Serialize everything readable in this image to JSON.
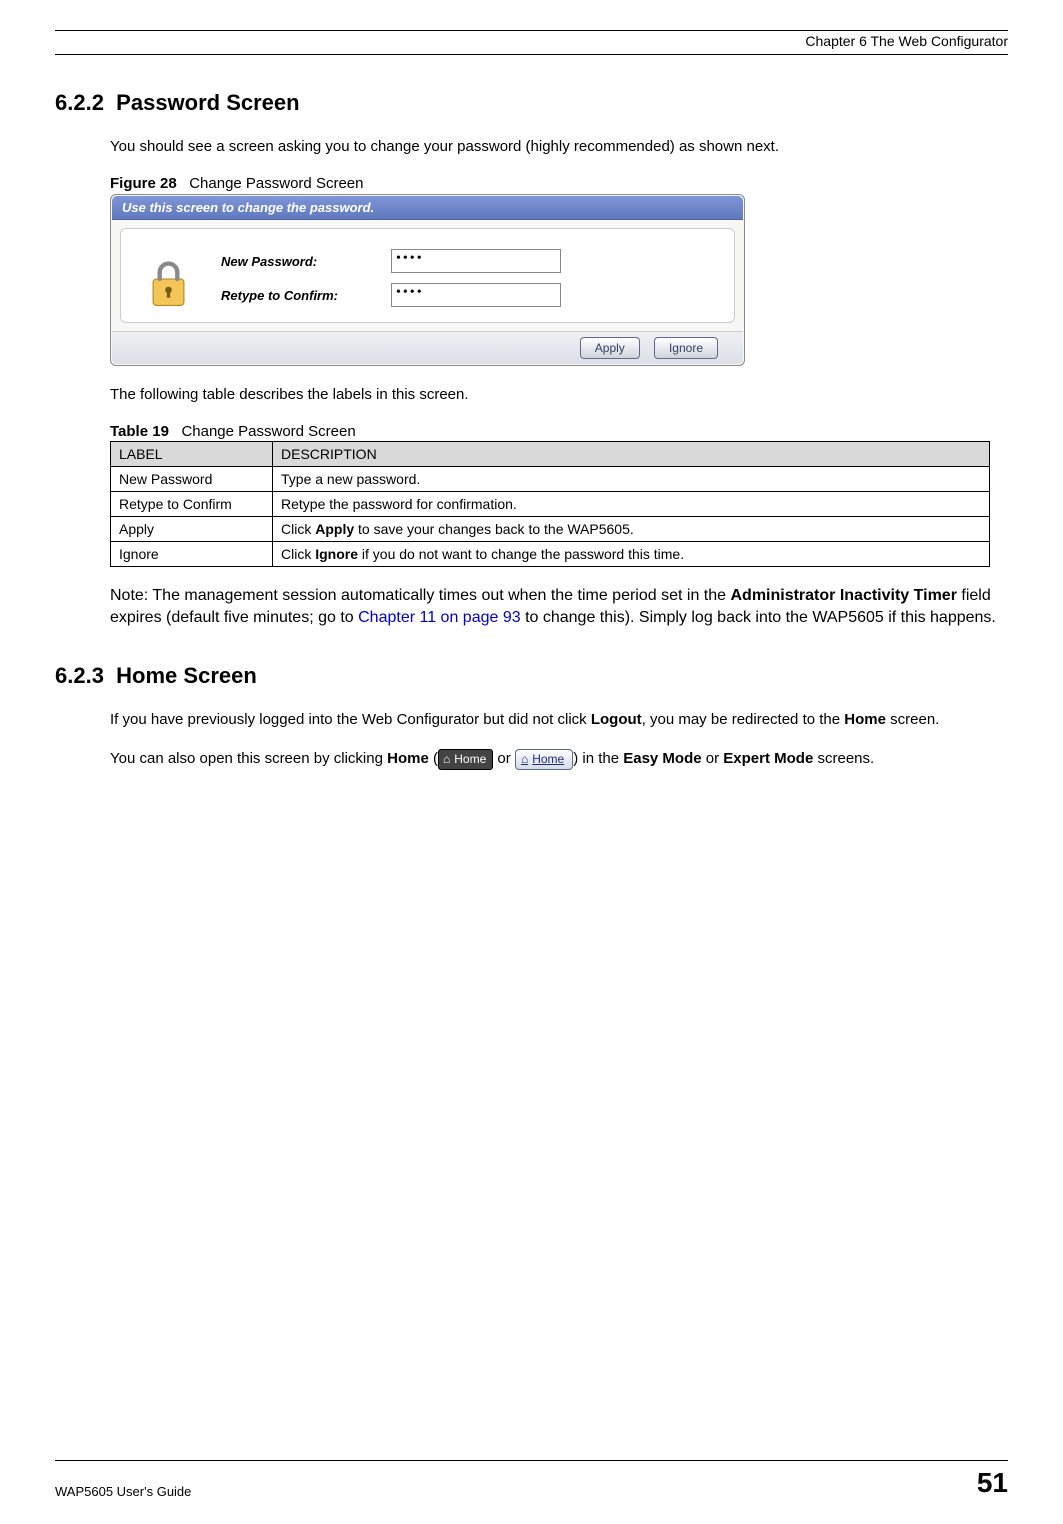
{
  "header": {
    "chapter_line": "Chapter 6 The Web Configurator"
  },
  "section622": {
    "number": "6.2.2",
    "title": "Password Screen",
    "intro": "You should see a screen asking you to change your password (highly recommended) as shown next."
  },
  "figure28": {
    "label": "Figure 28",
    "caption": "Change Password Screen",
    "banner": "Use this screen to change the password.",
    "new_password_label": "New Password:",
    "retype_label": "Retype to Confirm:",
    "dots": "••••",
    "apply_btn": "Apply",
    "ignore_btn": "Ignore"
  },
  "after_fig_para": "The following table describes the labels in this screen.",
  "table19": {
    "label": "Table 19",
    "caption": "Change Password Screen",
    "header_label": "LABEL",
    "header_desc": "DESCRIPTION",
    "rows": [
      {
        "label": "New Password",
        "desc_pre": "Type a new password.",
        "bold": "",
        "desc_post": ""
      },
      {
        "label": "Retype to Confirm",
        "desc_pre": "Retype the password for confirmation.",
        "bold": "",
        "desc_post": ""
      },
      {
        "label": "Apply",
        "desc_pre": "Click ",
        "bold": "Apply",
        "desc_post": " to save your changes back to the WAP5605."
      },
      {
        "label": "Ignore",
        "desc_pre": "Click ",
        "bold": "Ignore",
        "desc_post": " if you do not want to change the password this time."
      }
    ]
  },
  "note": {
    "prefix": "Note: The management session automatically times out when the time period set in the ",
    "bold1": "Administrator Inactivity Timer",
    "mid1": " field expires (default five minutes; go to ",
    "xref": "Chapter 11 on page 93",
    "mid2": " to change this). Simply log back into the WAP5605 if this happens."
  },
  "section623": {
    "number": "6.2.3",
    "title": "Home Screen",
    "para1_pre": "If you have previously logged into the Web Configurator but did not click ",
    "para1_bold1": "Logout",
    "para1_mid": ", you may be redirected to the ",
    "para1_bold2": "Home",
    "para1_post": " screen.",
    "para2_pre": "You can also open this screen by clicking ",
    "para2_home": "Home",
    "para2_open": " (",
    "home_dark_label": "Home",
    "para2_or": " or ",
    "home_light_label": "Home",
    "para2_close": ") in the ",
    "para2_em": "Easy Mode",
    "para2_or2": " or ",
    "para2_expert": "Expert Mode",
    "para2_end": " screens."
  },
  "footer": {
    "guide": "WAP5605 User's Guide",
    "page": "51"
  }
}
